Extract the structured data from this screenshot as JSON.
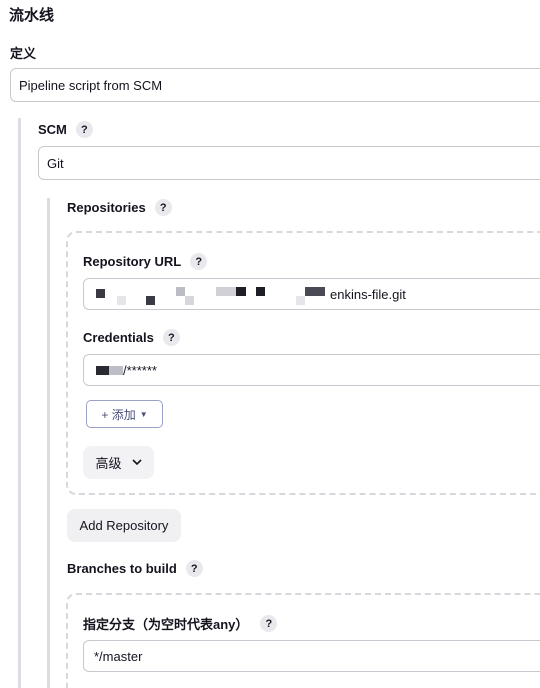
{
  "pipeline": {
    "section_title": "流水线",
    "definition_label": "定义",
    "definition_value": "Pipeline script from SCM"
  },
  "scm": {
    "label": "SCM",
    "help": "?",
    "value": "Git",
    "repositories": {
      "label": "Repositories",
      "help": "?",
      "repo_url_label": "Repository URL",
      "repo_url_help": "?",
      "repo_url_value_suffix": "enkins-file.git",
      "credentials_label": "Credentials",
      "credentials_help": "?",
      "credentials_value_suffix": "/******",
      "add_button": "+ 添加",
      "advanced_button": "高级",
      "add_repository_button": "Add Repository"
    },
    "branches": {
      "label": "Branches to build",
      "help": "?",
      "branch_spec_label": "指定分支（为空时代表any）",
      "branch_spec_help": "?",
      "branch_spec_value": "*/master"
    }
  },
  "colors": {
    "text": "#14141f",
    "border": "#c8c8d0",
    "help_bg": "#e9e9ed",
    "line": "#dcdce2"
  }
}
